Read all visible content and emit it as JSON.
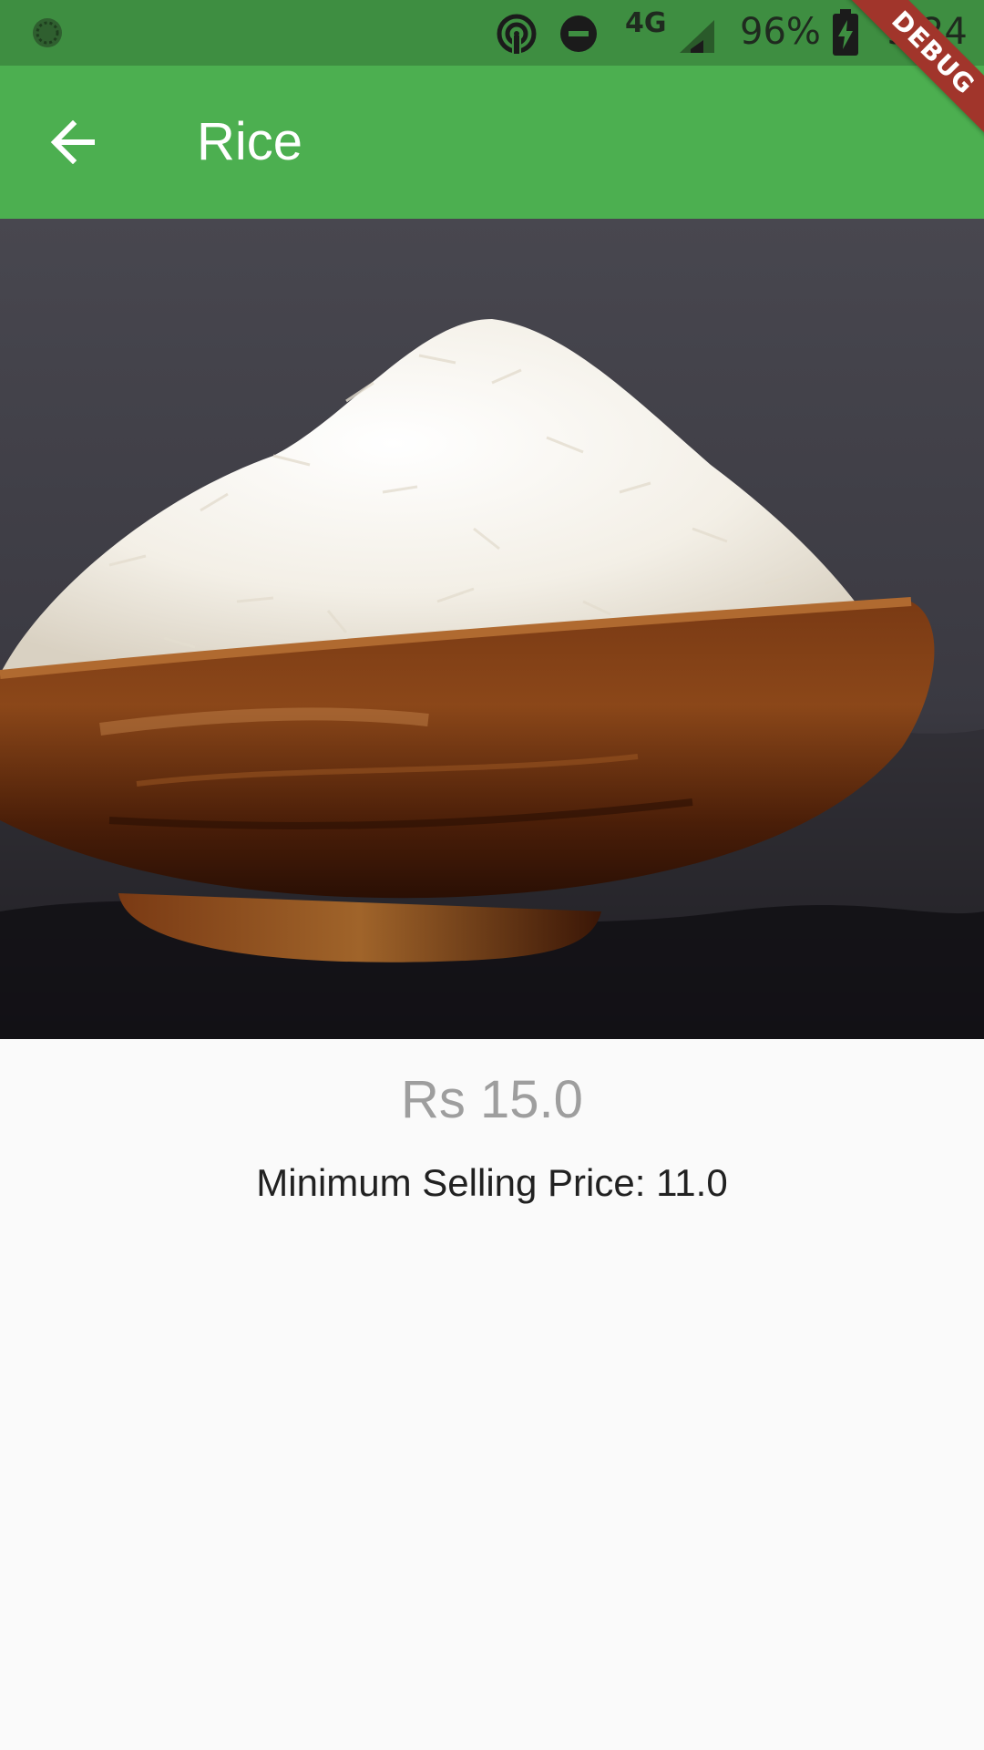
{
  "status_bar": {
    "network": "4G",
    "battery": "96%",
    "time": "9:24"
  },
  "app_bar": {
    "title": "Rice",
    "back_icon": "arrow-back-icon"
  },
  "debug_banner": "DEBUG",
  "product": {
    "image": "rice-bowl-image",
    "price": "Rs 15.0",
    "min_selling_price": "Minimum Selling Price: 11.0"
  },
  "colors": {
    "status_bar": "#3e8e41",
    "app_bar": "#4caf50",
    "debug_banner": "#a1352b",
    "price_text": "#9e9e9e"
  }
}
